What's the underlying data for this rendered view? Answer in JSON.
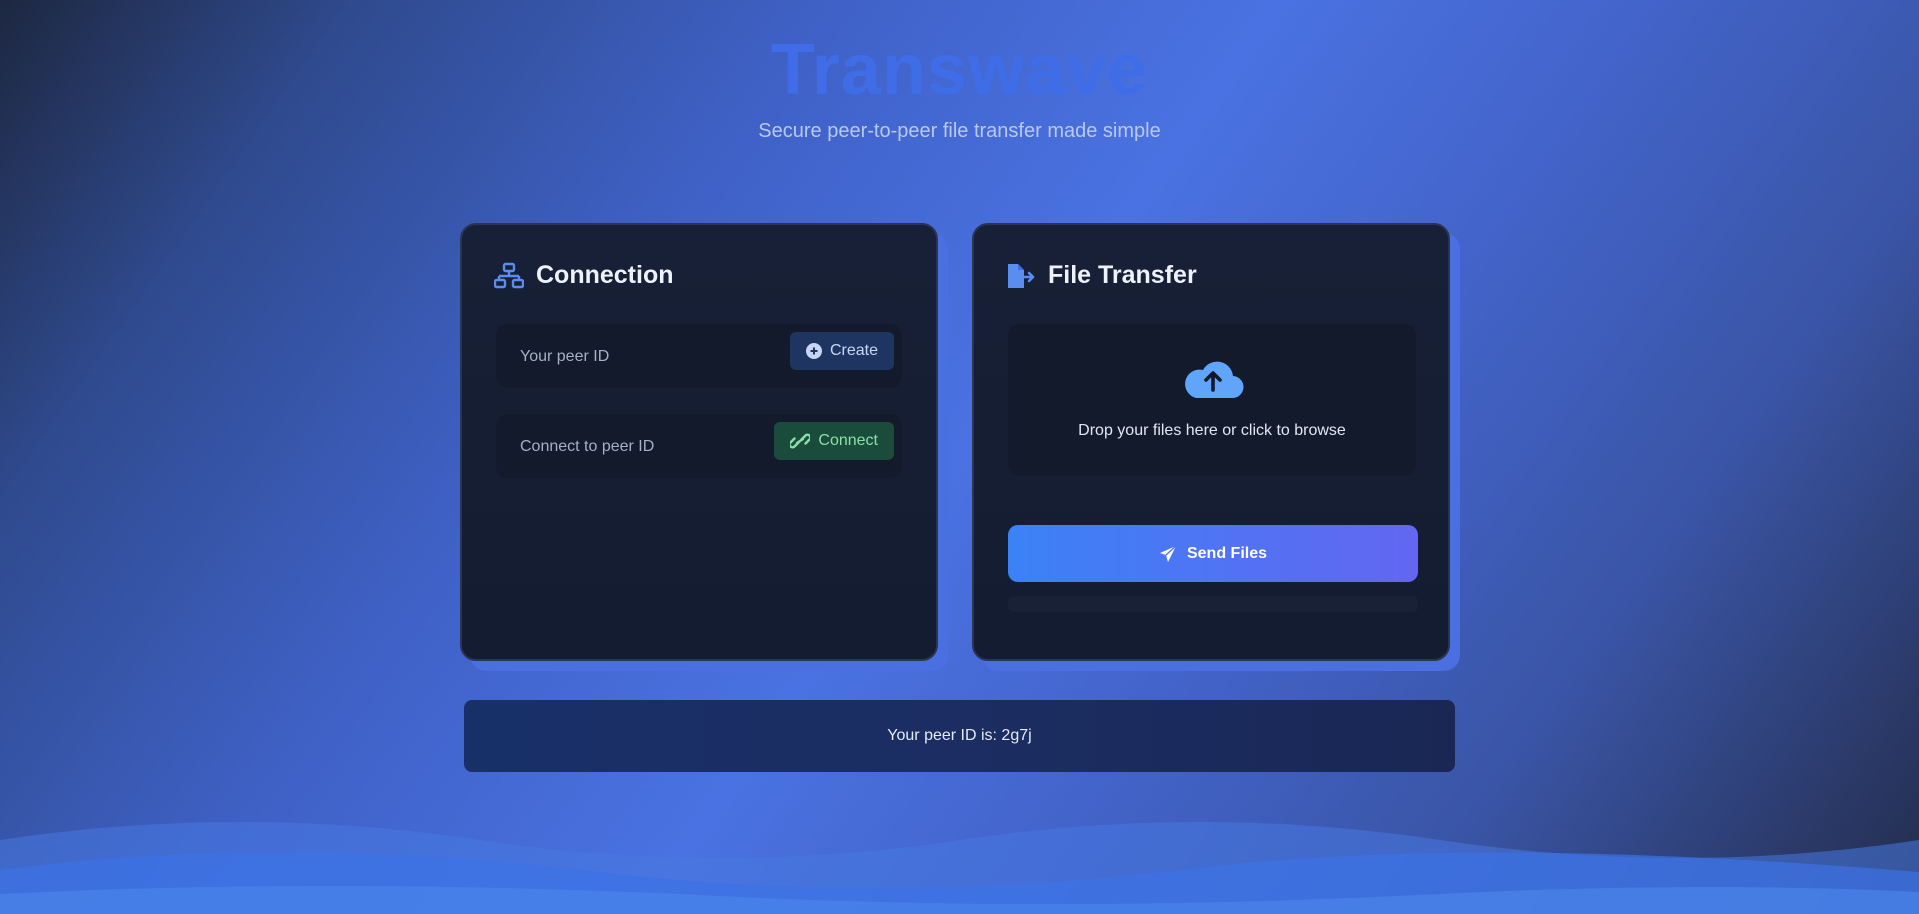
{
  "header": {
    "title": "Transwave",
    "subtitle": "Secure peer-to-peer file transfer made simple"
  },
  "connection": {
    "icon": "network-icon",
    "title": "Connection",
    "peer_id_label": "Your peer ID",
    "create_button": "Create",
    "connect_label": "Connect to peer ID",
    "connect_button": "Connect"
  },
  "transfer": {
    "icon": "file-export-icon",
    "title": "File Transfer",
    "dropzone_text": "Drop your files here or click to browse",
    "send_button": "Send Files"
  },
  "status": {
    "text": "Your peer ID is: 2g7j"
  },
  "colors": {
    "accent": "#3f6de8",
    "create_bg": "#1f3561",
    "connect_bg": "#1b4b3a",
    "connect_text": "#86e1a8",
    "send_gradient_start": "#3b82f6",
    "send_gradient_end": "#6366f1"
  }
}
